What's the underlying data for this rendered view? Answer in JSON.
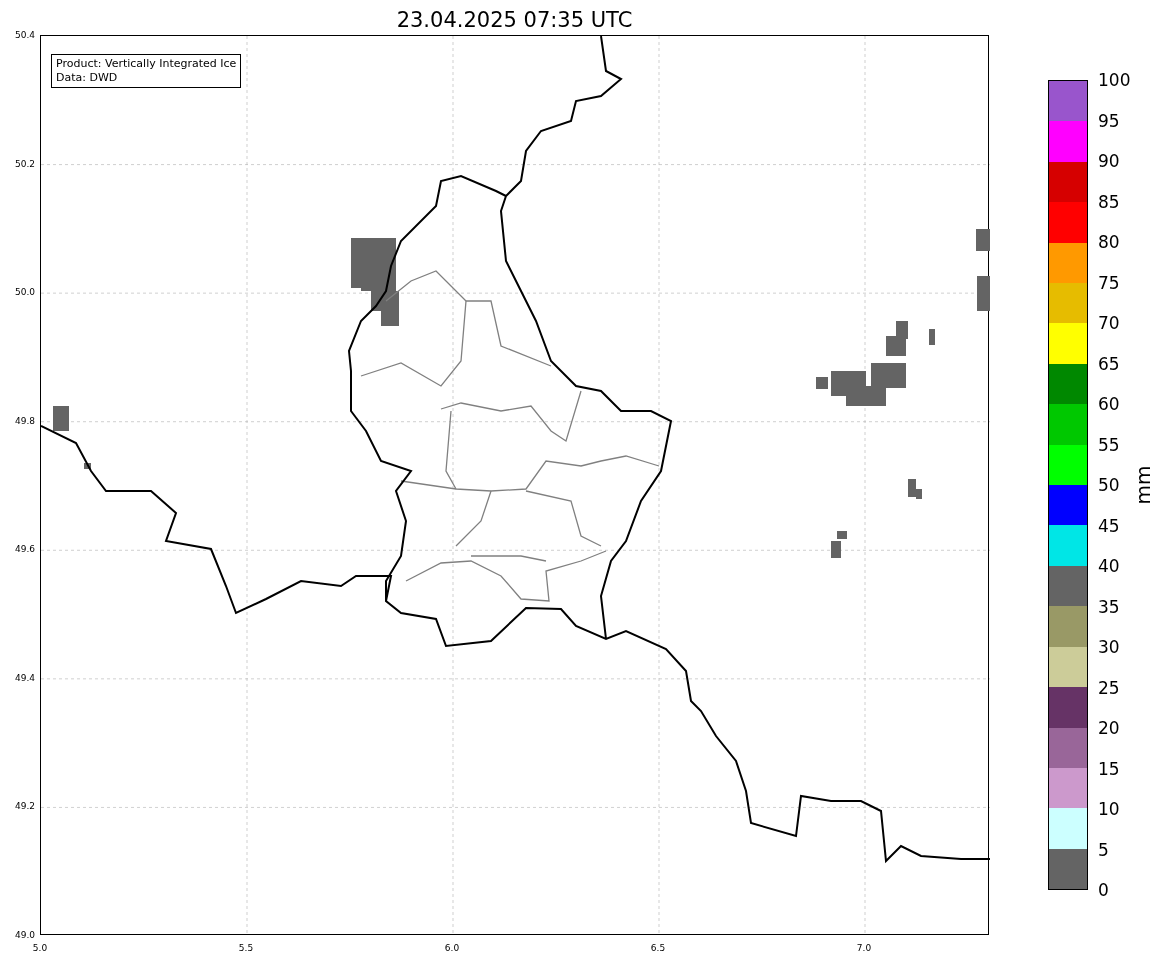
{
  "title": "23.04.2025 07:35 UTC",
  "legend": [
    "Product: Vertically Integrated Ice",
    "Data: DWD"
  ],
  "map": {
    "x_ticks": [
      "5.0",
      "5.5",
      "6.0",
      "6.5",
      "7.0"
    ],
    "y_ticks": [
      "50.4",
      "50.2",
      "50.0",
      "49.8",
      "49.6",
      "49.4",
      "49.2",
      "49.0"
    ]
  },
  "colorbar": {
    "unit": "mm",
    "ticks": [
      "100",
      "95",
      "90",
      "85",
      "80",
      "75",
      "70",
      "65",
      "60",
      "55",
      "50",
      "45",
      "40",
      "35",
      "30",
      "25",
      "20",
      "15",
      "10",
      "5",
      "0"
    ],
    "segments": [
      {
        "color": "#9955cc"
      },
      {
        "color": "#ff00ff"
      },
      {
        "color": "#d60000"
      },
      {
        "color": "#ff0000"
      },
      {
        "color": "#ff9900"
      },
      {
        "color": "#e6bc00"
      },
      {
        "color": "#ffff00"
      },
      {
        "color": "#008800"
      },
      {
        "color": "#00c800"
      },
      {
        "color": "#00ff00"
      },
      {
        "color": "#0000ff"
      },
      {
        "color": "#00e6e6"
      },
      {
        "color": "#646464"
      },
      {
        "color": "#999966"
      },
      {
        "color": "#cccc99"
      },
      {
        "color": "#663366"
      },
      {
        "color": "#996699"
      },
      {
        "color": "#cc99cc"
      },
      {
        "color": "#ccffff"
      },
      {
        "color": "#646464"
      }
    ]
  }
}
